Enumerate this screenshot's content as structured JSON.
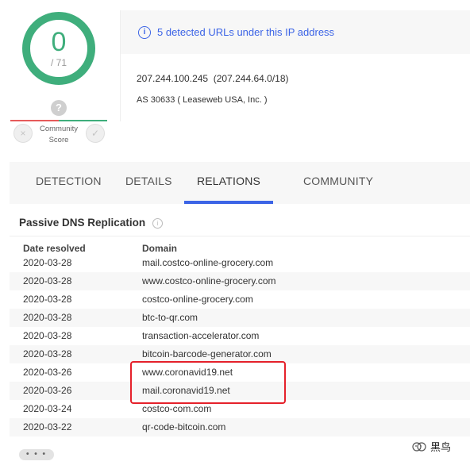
{
  "score": {
    "value": "0",
    "total": "/ 71",
    "ring_color": "#3fae7c"
  },
  "community": {
    "question": "?",
    "label": "Community\nScore",
    "downvote": "×",
    "upvote": "✓"
  },
  "summary": {
    "detected_urls": "5 detected URLs under this IP address",
    "ip": "207.244.100.245",
    "range": "(207.244.64.0/18)",
    "as": "AS 30633 ( Leaseweb USA, Inc. )"
  },
  "tabs": [
    {
      "label": "DETECTION"
    },
    {
      "label": "DETAILS"
    },
    {
      "label": "RELATIONS",
      "active": true
    },
    {
      "label": "COMMUNITY"
    }
  ],
  "passive_dns": {
    "title": "Passive DNS Replication",
    "info_icon": "i",
    "columns": [
      "Date resolved",
      "Domain"
    ],
    "rows": [
      [
        "2020-03-28",
        "mail.costco-online-grocery.com"
      ],
      [
        "2020-03-28",
        "www.costco-online-grocery.com"
      ],
      [
        "2020-03-28",
        "costco-online-grocery.com"
      ],
      [
        "2020-03-28",
        "btc-to-qr.com"
      ],
      [
        "2020-03-28",
        "transaction-accelerator.com"
      ],
      [
        "2020-03-28",
        "bitcoin-barcode-generator.com"
      ],
      [
        "2020-03-26",
        "www.coronavid19.net"
      ],
      [
        "2020-03-26",
        "mail.coronavid19.net"
      ],
      [
        "2020-03-24",
        "costco-com.com"
      ],
      [
        "2020-03-22",
        "qr-code-bitcoin.com"
      ]
    ],
    "more_label": "• • •"
  },
  "watermark": {
    "text": "黑鸟"
  },
  "colors": {
    "accent": "#3c64e6",
    "highlight": "#e5212b",
    "green": "#3fae7c",
    "red": "#e65b5b"
  }
}
